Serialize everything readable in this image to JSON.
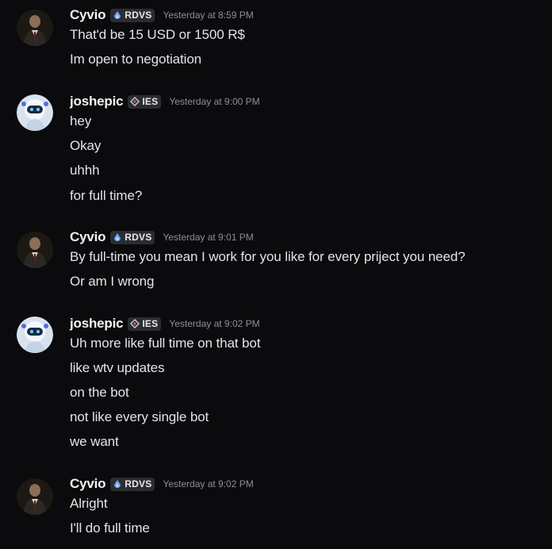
{
  "messages": [
    {
      "author": "Cyvio",
      "tag": "RDVS",
      "timestamp": "Yesterday at 8:59 PM",
      "lines": [
        "That'd be 15 USD or 1500 R$",
        "Im open to negotiation"
      ]
    },
    {
      "author": "joshepic",
      "tag": "IES",
      "timestamp": "Yesterday at 9:00 PM",
      "lines": [
        "hey",
        "Okay",
        "uhhh",
        "for full time?"
      ]
    },
    {
      "author": "Cyvio",
      "tag": "RDVS",
      "timestamp": "Yesterday at 9:01 PM",
      "lines": [
        "By full-time you mean I work for you like for every priject you need?",
        "Or am I wrong"
      ]
    },
    {
      "author": "joshepic",
      "tag": "IES",
      "timestamp": "Yesterday at 9:02 PM",
      "lines": [
        "Uh more like full time on that bot",
        "like wtv updates",
        "on the bot",
        "not like every single bot",
        "we want"
      ]
    },
    {
      "author": "Cyvio",
      "tag": "RDVS",
      "timestamp": "Yesterday at 9:02 PM",
      "lines": [
        "Alright",
        "I'll do full time"
      ]
    }
  ],
  "colors": {
    "background": "#0b0b0d",
    "username": "#f2f3f5",
    "message_text": "#e3e4e8",
    "timestamp": "#8e9096",
    "tag_background": "#2b2d31",
    "rdvs_icon": "#6fa3ff",
    "ies_icon": "#c8cdd6"
  },
  "icons": {
    "cyvio_avatar": "person-avatar",
    "joshepic_avatar": "robot-avatar",
    "rdvs_tag_icon": "droplet-icon",
    "ies_tag_icon": "diamond-star-icon"
  }
}
